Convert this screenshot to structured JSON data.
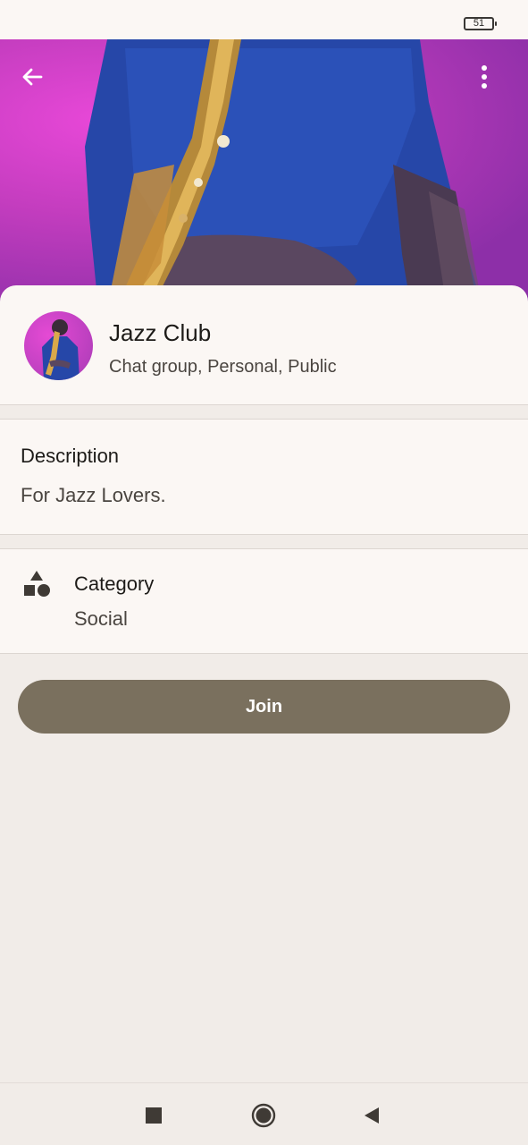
{
  "status_bar": {
    "battery": "51"
  },
  "header": {
    "back_icon": "arrow-left-icon",
    "menu_icon": "more-vert-icon"
  },
  "group": {
    "title": "Jazz Club",
    "subtitle": "Chat group, Personal, Public"
  },
  "description": {
    "label": "Description",
    "value": "For Jazz Lovers."
  },
  "category": {
    "icon": "category-shapes-icon",
    "label": "Category",
    "value": "Social"
  },
  "actions": {
    "join_label": "Join"
  },
  "nav": {
    "recents_icon": "square-icon",
    "home_icon": "circle-icon",
    "back_icon": "triangle-back-icon"
  },
  "colors": {
    "accent": "#7a705e",
    "surface": "#fbf7f4",
    "background": "#f1ece8"
  }
}
